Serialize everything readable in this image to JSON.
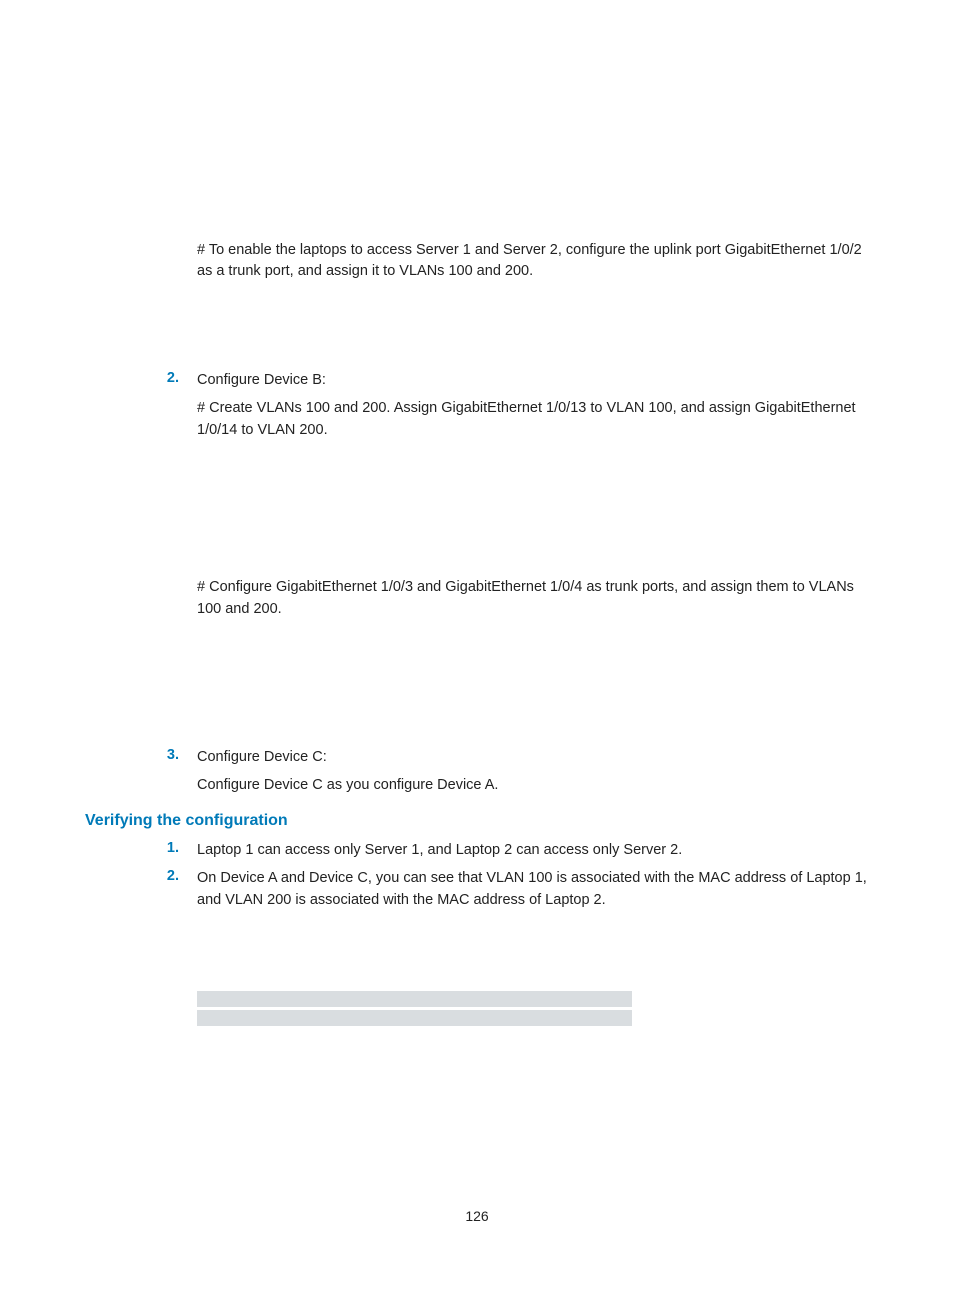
{
  "para1": "# To enable the laptops to access Server 1 and Server 2, configure the uplink port GigabitEthernet 1/0/2 as a trunk port, and assign it to VLANs 100 and 200.",
  "step2": {
    "num": "2.",
    "title": "Configure Device B:",
    "p1": "# Create VLANs 100 and 200. Assign GigabitEthernet 1/0/13 to VLAN 100, and assign GigabitEthernet 1/0/14 to VLAN 200.",
    "p2": "# Configure GigabitEthernet 1/0/3 and GigabitEthernet 1/0/4 as trunk ports, and assign them to VLANs 100 and 200."
  },
  "step3": {
    "num": "3.",
    "title": "Configure Device C:",
    "p1": "Configure Device C as you configure Device A."
  },
  "section": "Verifying the configuration",
  "v1": {
    "num": "1.",
    "text": "Laptop 1 can access only Server 1, and Laptop 2 can access only Server 2."
  },
  "v2": {
    "num": "2.",
    "text": "On Device A and Device C, you can see that VLAN 100 is associated with the MAC address of Laptop 1, and VLAN 200 is associated with the MAC address of Laptop 2."
  },
  "pagenum": "126"
}
